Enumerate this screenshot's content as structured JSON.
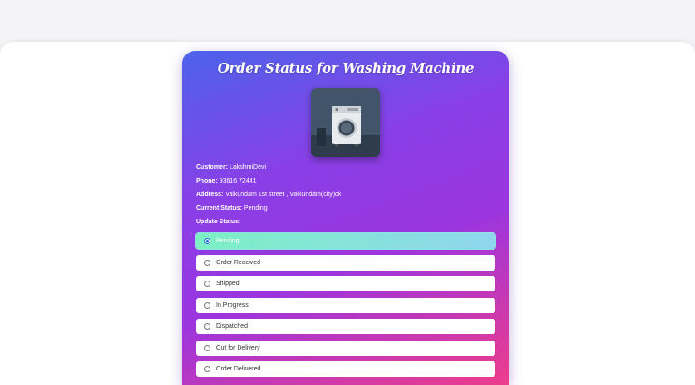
{
  "title": "Order Status for Washing Machine",
  "product_image": {
    "icon": "washing-machine-icon",
    "alt": "Washing Machine"
  },
  "customer": {
    "label": "Customer:",
    "value": "LakshmiDevi"
  },
  "phone": {
    "label": "Phone:",
    "value": "93616 72441"
  },
  "address": {
    "label": "Address:",
    "value": "Vaikundam 1st street , Vaikundam(city)ok"
  },
  "current_status": {
    "label": "Current Status:",
    "value": "Pending"
  },
  "update_status": {
    "label": "Update Status:"
  },
  "status_options": [
    {
      "label": "Pending",
      "selected": true
    },
    {
      "label": "Order Received",
      "selected": false
    },
    {
      "label": "Shipped",
      "selected": false
    },
    {
      "label": "In Progress",
      "selected": false
    },
    {
      "label": "Dispatched",
      "selected": false
    },
    {
      "label": "Out for Delivery",
      "selected": false
    },
    {
      "label": "Order Delivered",
      "selected": false
    }
  ],
  "colors": {
    "gradient_start": "#4c63ea",
    "gradient_mid": "#9a35e0",
    "gradient_end": "#ec3e8d",
    "selected_option": "#7df0c4",
    "radio_selected": "#1f6fe5"
  }
}
